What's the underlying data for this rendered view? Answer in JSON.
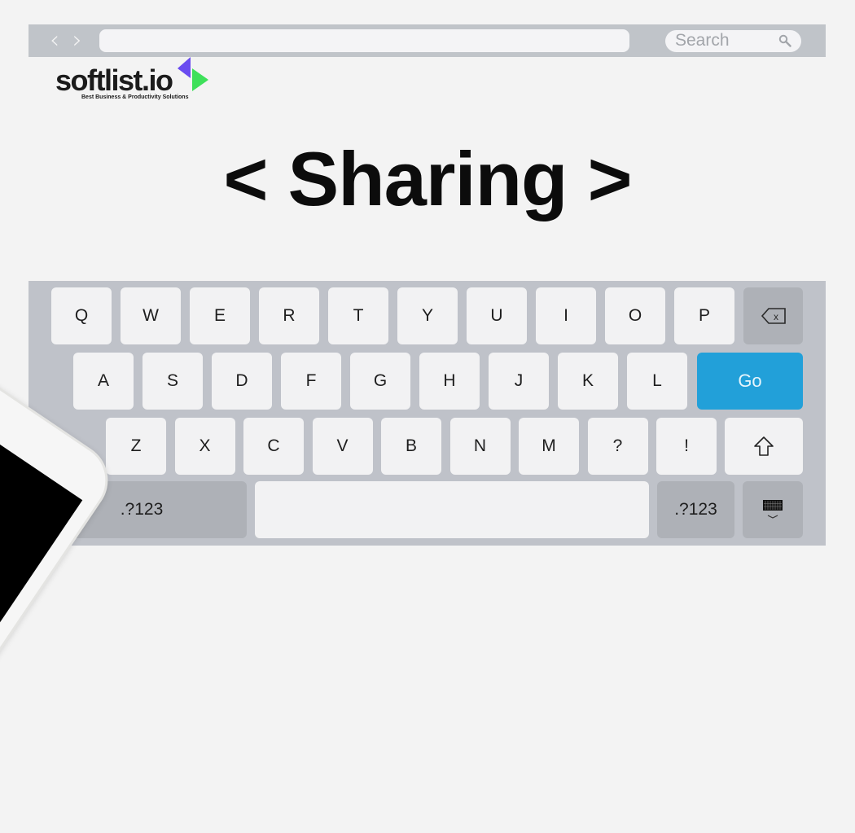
{
  "browser": {
    "back_label": "‹",
    "forward_label": "›",
    "url_value": "",
    "search_placeholder": "Search"
  },
  "logo": {
    "name": "softlist.io",
    "tagline": "Best Business & Productivity Solutions",
    "colors": {
      "triangle_purple": "#6a4cf0",
      "triangle_green": "#3ee05a",
      "dot_pink": "#e8477a"
    }
  },
  "headline": "< Sharing >",
  "keyboard": {
    "row1": [
      "Q",
      "W",
      "E",
      "R",
      "T",
      "Y",
      "U",
      "I",
      "O",
      "P"
    ],
    "row2": [
      "A",
      "S",
      "D",
      "F",
      "G",
      "H",
      "J",
      "K",
      "L"
    ],
    "row3": [
      "Z",
      "X",
      "C",
      "V",
      "B",
      "N",
      "M",
      "?",
      "!"
    ],
    "go_label": "Go",
    "numbers_left_label": ".?123",
    "numbers_right_label": ".?123",
    "backspace_icon": "backspace-icon",
    "shift_icon": "shift-icon",
    "hide_keyboard_icon": "keyboard-hide-icon",
    "accent_color": "#22a0d9"
  },
  "phone": {
    "screen": "black"
  }
}
